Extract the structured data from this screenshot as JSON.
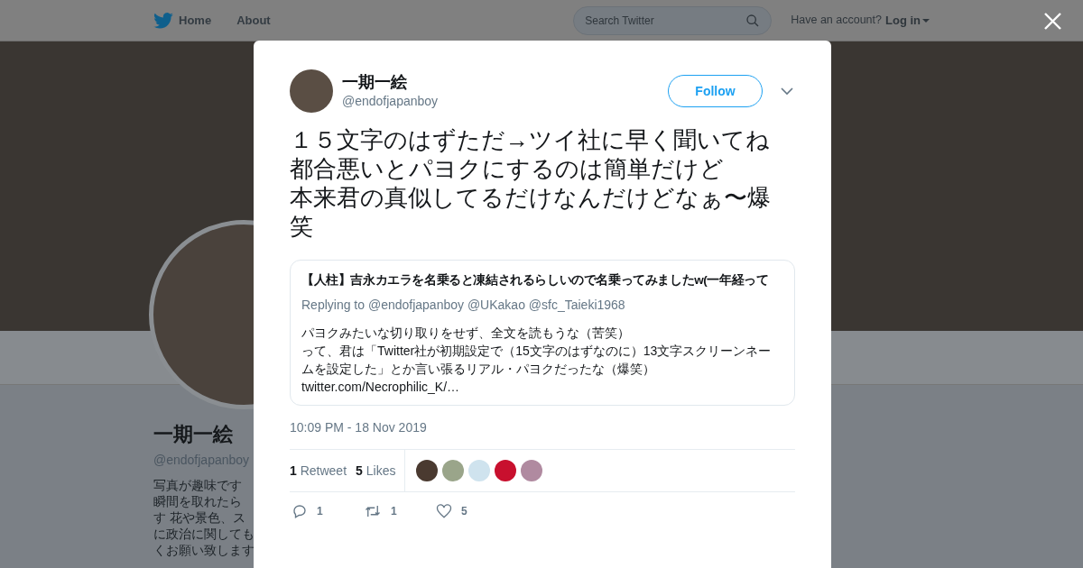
{
  "nav": {
    "home": "Home",
    "about": "About",
    "search": {
      "placeholder": "Search Twitter"
    },
    "account_prompt": "Have an account?",
    "login": "Log in"
  },
  "profile": {
    "name": "一期一絵",
    "handle": "@endofjapanboy",
    "bio": [
      "写真が趣味です",
      "瞬間を取れたら",
      "す 花や景色、ス",
      "に政治に関しても",
      "くお願い致します"
    ]
  },
  "tweet": {
    "name": "一期一絵",
    "handle": "@endofjapanboy",
    "follow": "Follow",
    "text": [
      "１５文字のはずただ→ツイ社に早く聞いてね",
      "都合悪いとパヨクにするのは簡単だけど",
      "本来君の真似してるだけなんだけどなぁ〜爆笑"
    ],
    "quote": {
      "title": "【人柱】吉永カエラを名乗ると凍結されるらしいので名乗ってみましたw(一年経って",
      "replying_label": "Replying to",
      "mentions": [
        "@endofjapanboy",
        "@UKakao",
        "@sfc_Taieki1968"
      ],
      "text": [
        "パヨクみたいな切り取りをせず、全文を読もうな（苦笑）",
        "って、君は「Twitter社が初期設定で（15文字のはずなのに）13文字スクリーンネームを設定した」とか言い張るリアル・パヨクだったな（爆笑）"
      ],
      "link": "twitter.com/Necrophilic_K/…"
    },
    "time": "10:09 PM - 18 Nov 2019",
    "stats": [
      {
        "count": "1",
        "label": "Retweet"
      },
      {
        "count": "5",
        "label": "Likes"
      }
    ],
    "likers": [
      {
        "color": "#4a3a30"
      },
      {
        "color": "#9aa58a"
      },
      {
        "color": "#cfe3ee"
      },
      {
        "color": "#c8102e"
      },
      {
        "color": "#b08aa0"
      }
    ],
    "actions": [
      {
        "kind": "reply",
        "count": "1"
      },
      {
        "kind": "retweet",
        "count": "1"
      },
      {
        "kind": "like",
        "count": "5"
      }
    ]
  }
}
